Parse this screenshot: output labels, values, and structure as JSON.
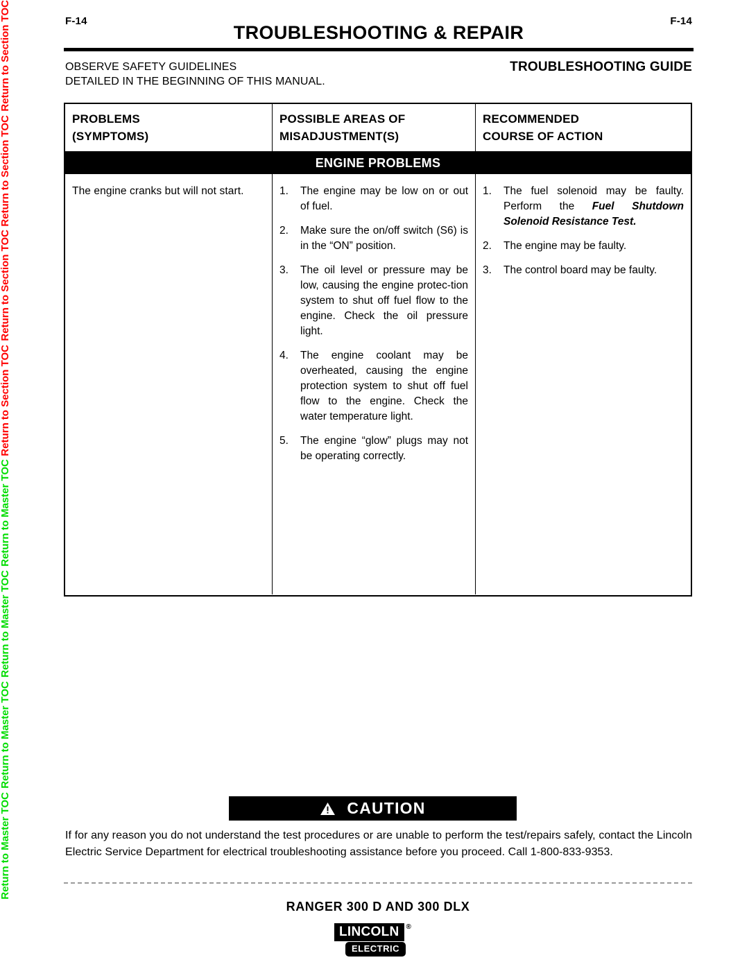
{
  "nav_rail": {
    "section_toc_label": "Return to Section TOC",
    "master_toc_label": "Return to Master TOC",
    "repeat_count": 4,
    "section_toc_color": "#ff0000",
    "master_toc_color": "#00dd00"
  },
  "header": {
    "page_number_left": "F-14",
    "page_number_right": "F-14",
    "section_title": "TROUBLESHOOTING & REPAIR",
    "safety_note_line1": "OBSERVE SAFETY GUIDELINES",
    "safety_note_line2": "DETAILED IN THE BEGINNING OF THIS MANUAL.",
    "guide_title": "TROUBLESHOOTING GUIDE"
  },
  "table": {
    "columns": [
      {
        "line1": "PROBLEMS",
        "line2": "(SYMPTOMS)"
      },
      {
        "line1": "POSSIBLE AREAS OF",
        "line2": "MISADJUSTMENT(S)"
      },
      {
        "line1": "RECOMMENDED",
        "line2": "COURSE OF ACTION"
      }
    ],
    "section_band": "ENGINE PROBLEMS",
    "row": {
      "symptom": "The engine cranks but will not start.",
      "possible_areas": [
        "The engine may be low on or out of fuel.",
        "Make sure the on/off switch (S6) is in the “ON” position.",
        "The oil level or pressure may be low, causing the engine protec-tion system to shut off fuel flow to the engine.  Check the oil pressure light.",
        "The engine coolant may be overheated, causing the engine protection system to shut off fuel flow to the engine.  Check the water temperature light.",
        "The engine “glow” plugs may not be operating correctly."
      ],
      "recommended_actions": [
        {
          "text_before": "The fuel solenoid may be faulty. Perform the ",
          "emphasis": "Fuel Shutdown Solenoid Resistance Test.",
          "text_after": ""
        },
        {
          "text_before": "The engine may be faulty.",
          "emphasis": "",
          "text_after": ""
        },
        {
          "text_before": "The control board may be faulty.",
          "emphasis": "",
          "text_after": ""
        }
      ]
    }
  },
  "caution": {
    "icon": "warning-triangle-icon",
    "label": "CAUTION",
    "body": "If for any reason you do not understand the test procedures or are unable to perform the test/repairs safely, contact the Lincoln Electric Service Department for electrical troubleshooting assistance before you proceed.  Call 1-800-833-9353."
  },
  "footer": {
    "product_name": "RANGER 300 D AND 300 DLX",
    "logo_wordmark": "LINCOLN",
    "logo_registered_mark": "®",
    "logo_subword": "ELECTRIC"
  }
}
